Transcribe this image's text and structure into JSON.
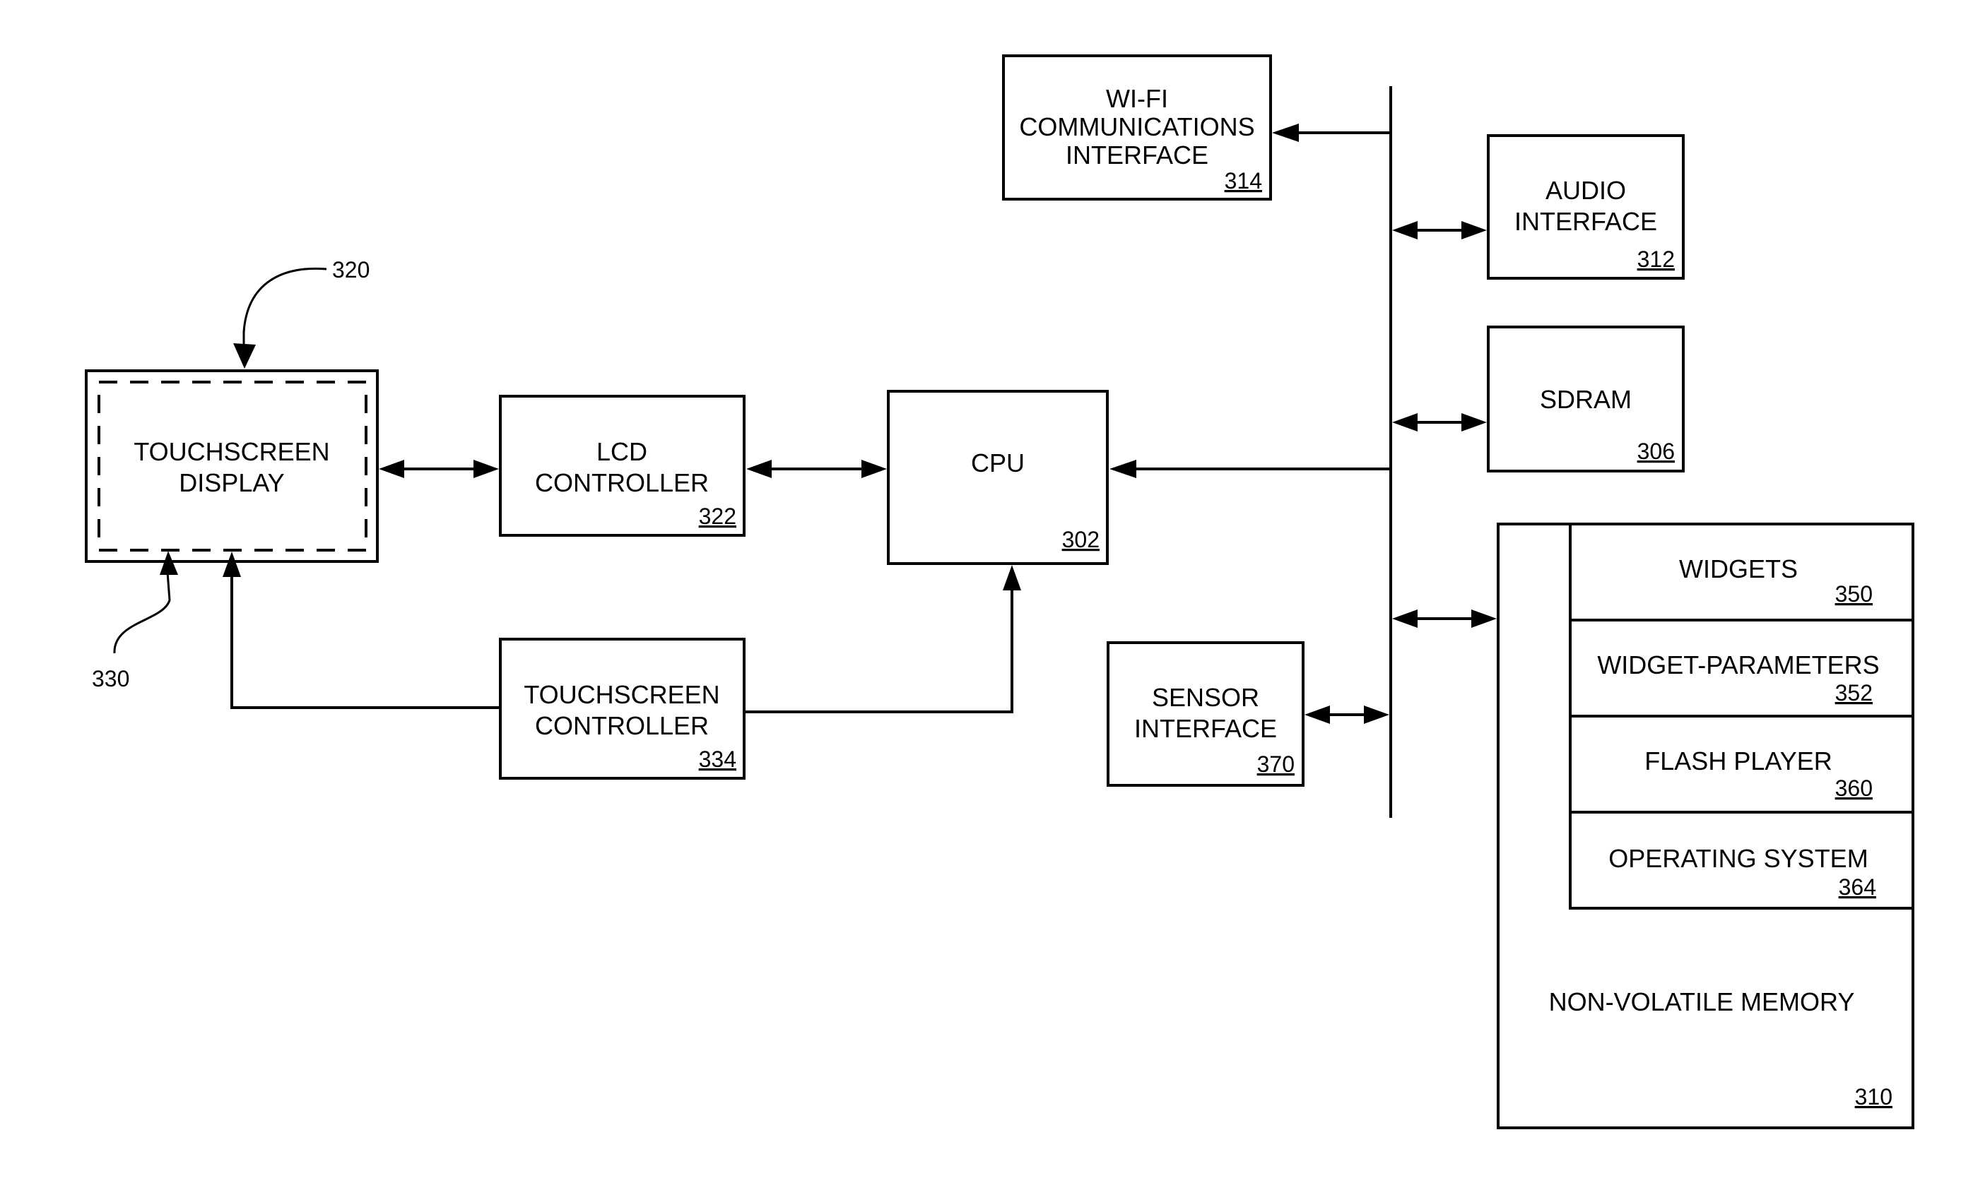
{
  "figure": {
    "blocks": {
      "wifi": {
        "lines": [
          "WI-FI",
          "COMMUNICATIONS",
          "INTERFACE"
        ],
        "ref": "314"
      },
      "audio": {
        "lines": [
          "AUDIO",
          "INTERFACE"
        ],
        "ref": "312"
      },
      "sdram": {
        "lines": [
          "SDRAM"
        ],
        "ref": "306"
      },
      "cpu": {
        "lines": [
          "CPU"
        ],
        "ref": "302"
      },
      "lcd": {
        "lines": [
          "LCD",
          "CONTROLLER"
        ],
        "ref": "322"
      },
      "tsdisp": {
        "lines": [
          "TOUCHSCREEN",
          "DISPLAY"
        ]
      },
      "tsctrl": {
        "lines": [
          "TOUCHSCREEN",
          "CONTROLLER"
        ],
        "ref": "334"
      },
      "sensor": {
        "lines": [
          "SENSOR",
          "INTERFACE"
        ],
        "ref": "370"
      },
      "nvm": {
        "lines": [
          "NON-VOLATILE MEMORY"
        ],
        "ref": "310"
      }
    },
    "memory_contents": [
      {
        "label": "WIDGETS",
        "ref": "350"
      },
      {
        "label": "WIDGET-PARAMETERS",
        "ref": "352"
      },
      {
        "label": "FLASH PLAYER",
        "ref": "360"
      },
      {
        "label": "OPERATING SYSTEM",
        "ref": "364"
      }
    ],
    "callouts": {
      "display_device": "320",
      "touch_surface": "330"
    }
  }
}
